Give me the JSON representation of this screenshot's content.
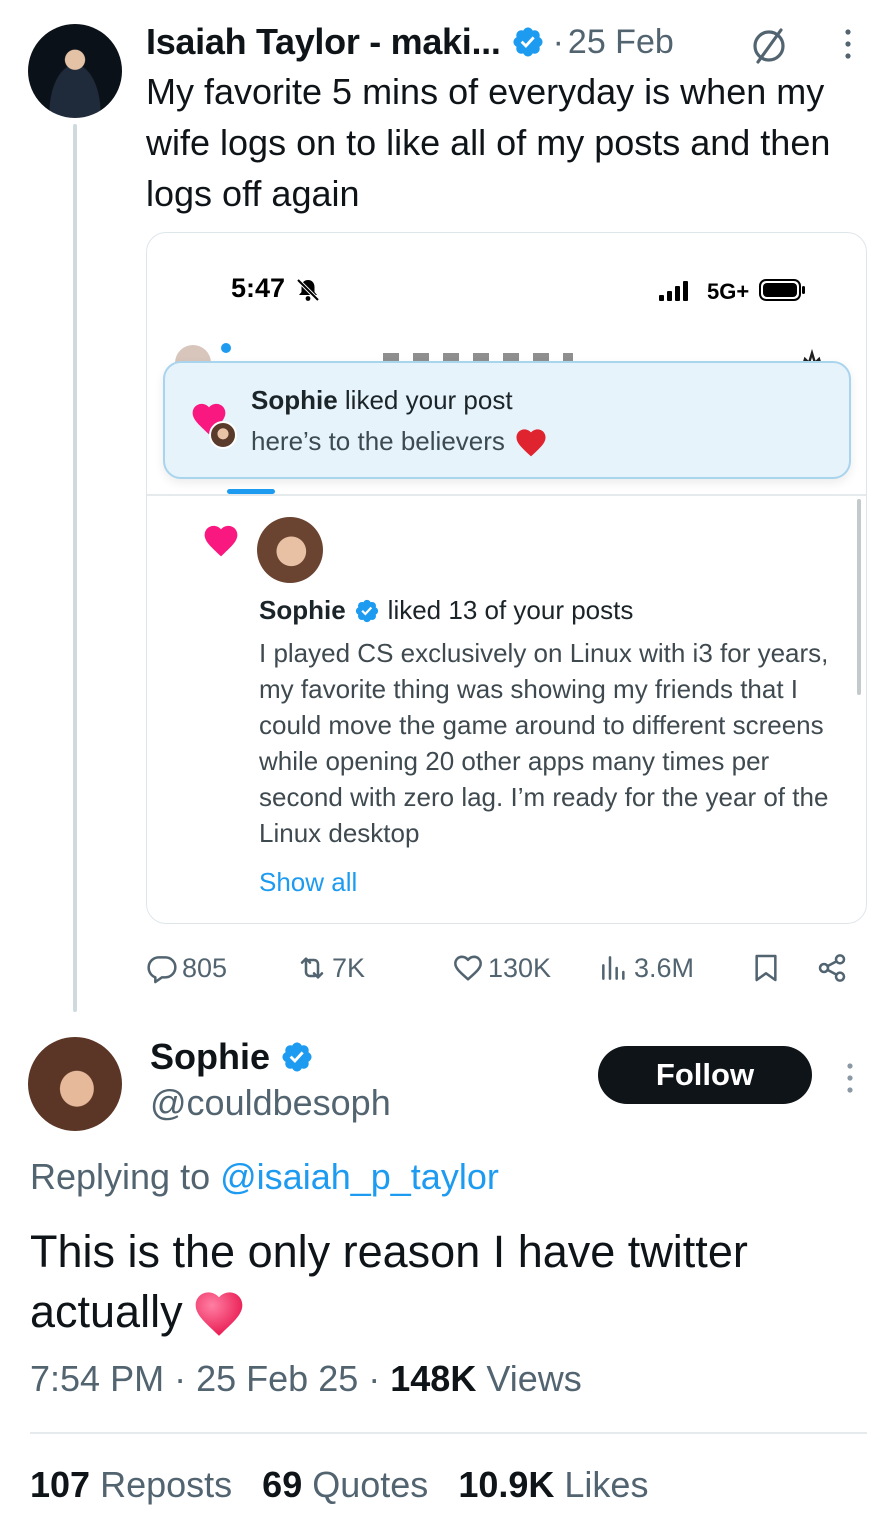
{
  "parent": {
    "name": "Isaiah Taylor - maki...",
    "date_separator": "·",
    "date": "25 Feb",
    "text": "My favorite 5 mins of everyday is when my wife logs on to like all of my posts and then logs off again",
    "avatar_icon": "avatar-isaiah",
    "colors": {
      "verified": "#1d9bf0",
      "muted": "#536471"
    }
  },
  "card": {
    "status_time": "5:47",
    "network": "5G+",
    "toast": {
      "actor": "Sophie",
      "action": "liked your post",
      "post_text": "here’s to the believers"
    },
    "notification": {
      "actor": "Sophie",
      "action": "liked 13 of your posts",
      "body": "I played CS exclusively on Linux with i3 for years, my favorite thing was showing my friends that I could move the game around to different screens while opening 20 other apps many times per second with zero lag. I’m ready for the year of the Linux desktop",
      "show_all": "Show all"
    },
    "colors": {
      "toast_bg": "#e6f3fb",
      "heart": "#f91880",
      "link": "#1d9bf0"
    }
  },
  "actions": {
    "replies": "805",
    "reposts": "7K",
    "likes": "130K",
    "views": "3.6M"
  },
  "reply": {
    "name": "Sophie",
    "handle": "@couldbesoph",
    "follow_label": "Follow",
    "replying_prefix": "Replying to",
    "replying_to": "@isaiah_p_taylor",
    "text": "This is the only reason I have twitter actually",
    "time": "7:54 PM",
    "sep1": "·",
    "date": "25 Feb 25",
    "sep2": "·",
    "views_count": "148K",
    "views_label": "Views",
    "stats": [
      {
        "count": "107",
        "label": "Reposts"
      },
      {
        "count": "69",
        "label": "Quotes"
      },
      {
        "count": "10.9K",
        "label": "Likes"
      }
    ]
  }
}
